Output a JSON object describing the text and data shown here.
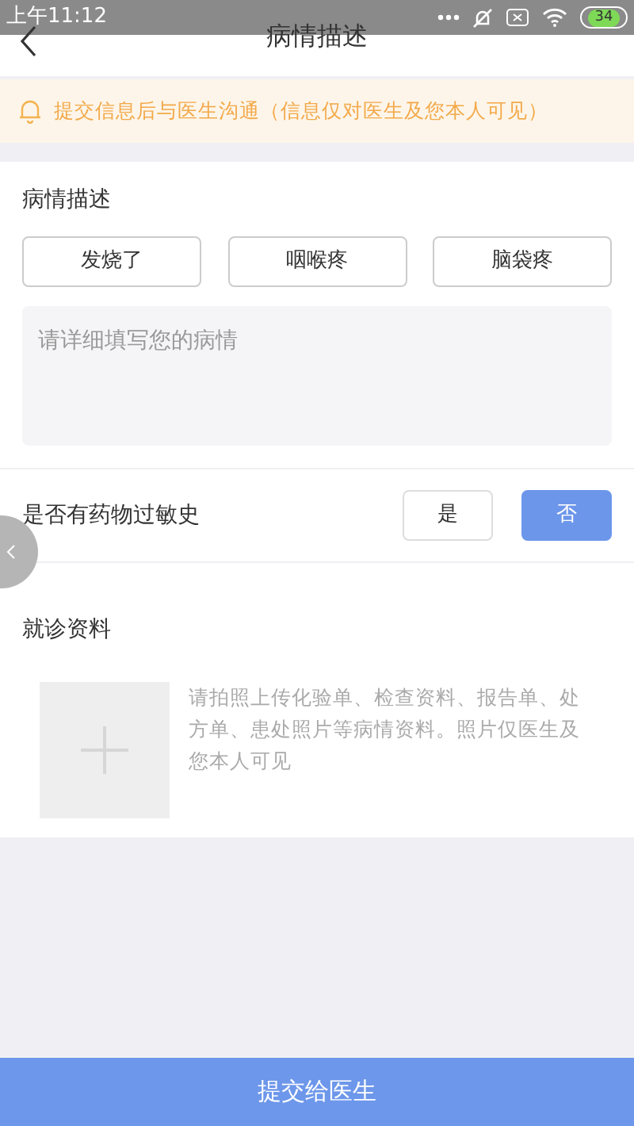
{
  "status_bar": {
    "time": "上午11:12",
    "battery": "34"
  },
  "header": {
    "title": "病情描述"
  },
  "notice": {
    "text": "提交信息后与医生沟通（信息仅对医生及您本人可见）"
  },
  "description": {
    "title": "病情描述",
    "tags": [
      {
        "label": "发烧了",
        "selected": false
      },
      {
        "label": "咽喉疼",
        "selected": false
      },
      {
        "label": "脑袋疼",
        "selected": false
      }
    ],
    "placeholder": "请详细填写您的病情"
  },
  "allergy": {
    "label": "是否有药物过敏史",
    "options": [
      {
        "label": "是",
        "selected": false
      },
      {
        "label": "否",
        "selected": true
      }
    ]
  },
  "records": {
    "title": "就诊资料",
    "hint": "请拍照上传化验单、检查资料、报告单、处方单、患处照片等病情资料。照片仅医生及您本人可见"
  },
  "submit": {
    "label": "提交给医生"
  }
}
